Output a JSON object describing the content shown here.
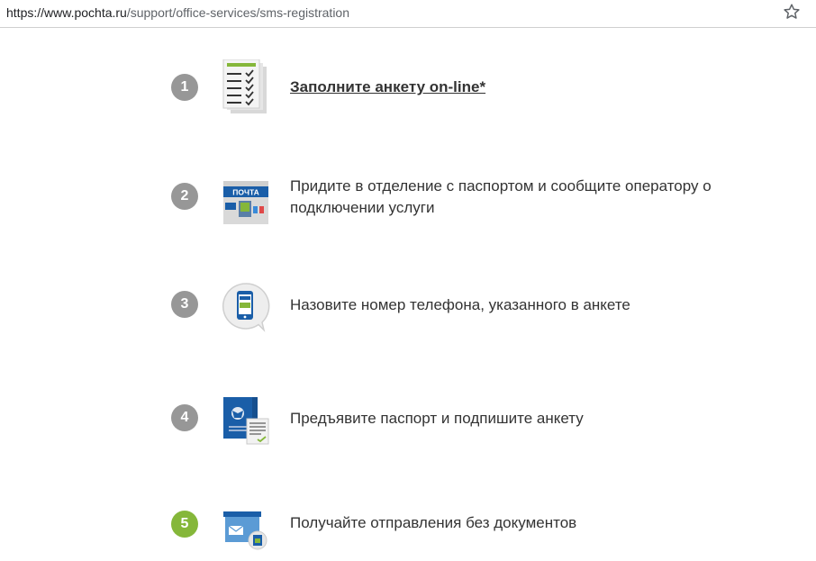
{
  "browser": {
    "url_host": "https://www.pochta.ru",
    "url_path": "/support/office-services/sms-registration"
  },
  "steps": [
    {
      "number": "1",
      "text": "Заполните анкету on-line*",
      "icon": "form-checklist-icon"
    },
    {
      "number": "2",
      "text": "Придите в отделение с паспортом и сообщите оператору о подключении услуги",
      "icon": "post-office-icon",
      "sign": "ПОЧТА"
    },
    {
      "number": "3",
      "text": "Назовите номер телефона, указанного в анкете",
      "icon": "phone-bubble-icon"
    },
    {
      "number": "4",
      "text": "Предъявите паспорт и подпишите анкету",
      "icon": "passport-sign-icon"
    },
    {
      "number": "5",
      "text": "Получайте отправления без документов",
      "icon": "parcel-receive-icon"
    }
  ],
  "colors": {
    "step_inactive": "#979797",
    "step_active": "#85b73a",
    "brand_blue": "#1a5ea8",
    "green": "#85b73a"
  }
}
